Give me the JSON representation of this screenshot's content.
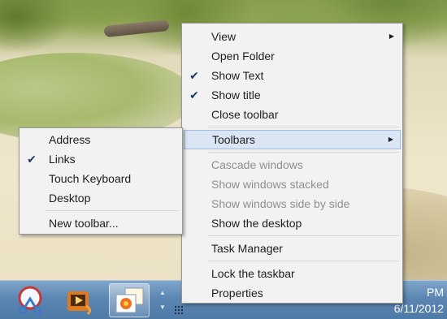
{
  "desktop": {
    "wallpaper": "beach"
  },
  "taskbar": {
    "apps": [
      {
        "icon": "snipping-tool-icon"
      },
      {
        "icon": "media-player-icon"
      },
      {
        "icon": "paint-icon"
      }
    ],
    "clock": {
      "time": "PM",
      "date": "6/11/2012"
    }
  },
  "menu": {
    "items": [
      {
        "label": "View",
        "submenu": true
      },
      {
        "label": "Open Folder"
      },
      {
        "label": "Show Text",
        "checked": true
      },
      {
        "label": "Show title",
        "checked": true
      },
      {
        "label": "Close toolbar"
      },
      {
        "label": "Toolbars",
        "submenu": true,
        "highlighted": true
      },
      {
        "label": "Cascade windows",
        "disabled": true
      },
      {
        "label": "Show windows stacked",
        "disabled": true
      },
      {
        "label": "Show windows side by side",
        "disabled": true
      },
      {
        "label": "Show the desktop"
      },
      {
        "label": "Task Manager"
      },
      {
        "label": "Lock the taskbar"
      },
      {
        "label": "Properties"
      }
    ]
  },
  "submenu": {
    "items": [
      {
        "label": "Address"
      },
      {
        "label": "Links",
        "checked": true
      },
      {
        "label": "Touch Keyboard"
      },
      {
        "label": "Desktop"
      },
      {
        "label": "New toolbar..."
      }
    ]
  },
  "colors": {
    "menu_bg": "#f2f2f2",
    "highlight_bg": "#dbe6f4",
    "highlight_border": "#9bbbe3",
    "disabled_text": "#8f8f8f",
    "taskbar": "#5c86b2"
  }
}
